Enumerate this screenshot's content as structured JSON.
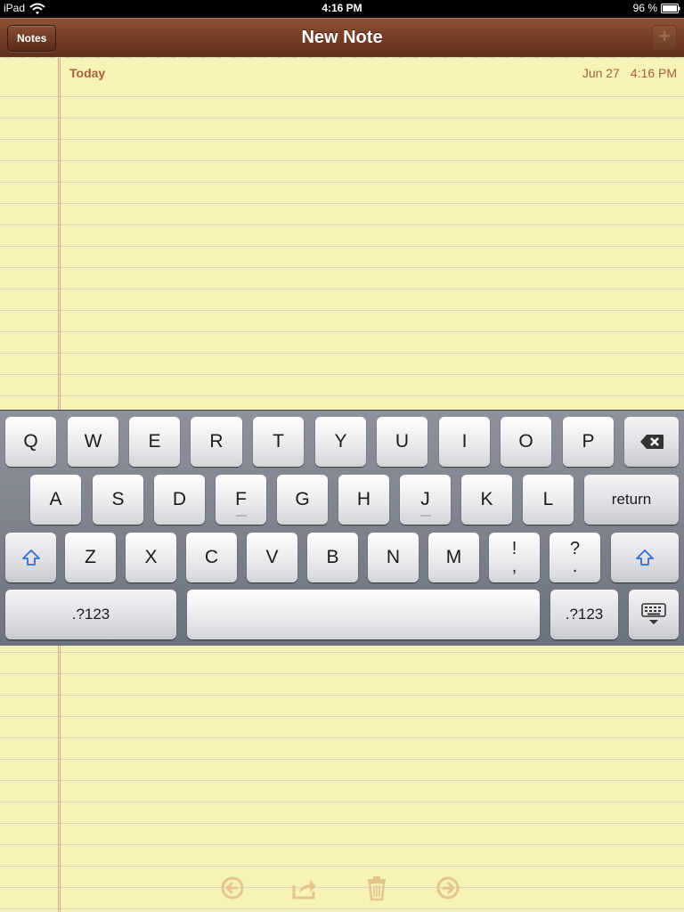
{
  "status_bar": {
    "device": "iPad",
    "time": "4:16 PM",
    "battery": "96 %"
  },
  "nav_bar": {
    "back_label": "Notes",
    "title": "New Note",
    "add_label": "+"
  },
  "note": {
    "day_label": "Today",
    "date": "Jun 27",
    "time": "4:16 PM"
  },
  "keyboard": {
    "row1": [
      "Q",
      "W",
      "E",
      "R",
      "T",
      "Y",
      "U",
      "I",
      "O",
      "P"
    ],
    "row2": [
      "A",
      "S",
      "D",
      "F",
      "G",
      "H",
      "J",
      "K",
      "L"
    ],
    "return_label": "return",
    "row3": [
      "Z",
      "X",
      "C",
      "V",
      "B",
      "N",
      "M"
    ],
    "punct1_top": "!",
    "punct1_bottom": ",",
    "punct2_top": "?",
    "punct2_bottom": ".",
    "numbers_label": ".?123"
  },
  "toolbar": {
    "icons": [
      "back-arrow-icon",
      "share-icon",
      "trash-icon",
      "forward-arrow-icon"
    ]
  },
  "colors": {
    "paper": "#f7f3b7",
    "leather": "#7a4129",
    "note_text": "#a8603c",
    "toolbar_icon": "#e5c58e"
  }
}
